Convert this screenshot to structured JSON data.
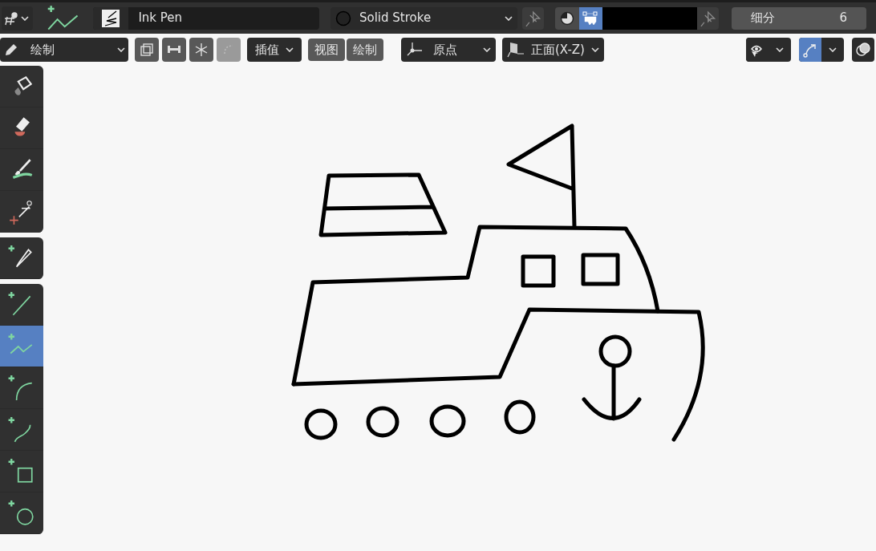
{
  "header": {
    "brush": "Ink Pen",
    "material": "Solid Stroke",
    "color_modes": [
      {
        "kind": "material",
        "selected": false
      },
      {
        "kind": "vertex",
        "selected": true
      }
    ],
    "subdivision": {
      "label": "细分",
      "value": "6"
    }
  },
  "toolbar": {
    "mode": "绘制",
    "toggles": [
      {
        "kind": "layers",
        "disabled": false
      },
      {
        "kind": "lock",
        "disabled": false
      },
      {
        "kind": "freeze",
        "disabled": false
      },
      {
        "kind": "chain",
        "disabled": true
      }
    ],
    "interpolate": "插值",
    "buttons": [
      "视图",
      "绘制"
    ],
    "pivot": "原点",
    "plane": "正面(X-Z)",
    "overlays": [
      {
        "kind": "visibility",
        "selected": false
      },
      {
        "kind": "gizmo",
        "selected": true
      },
      {
        "kind": "overlay",
        "selected": false
      }
    ]
  },
  "tools": [
    [
      {
        "kind": "fill",
        "selected": false
      },
      {
        "kind": "erase",
        "selected": false
      },
      {
        "kind": "tint",
        "selected": false
      },
      {
        "kind": "cutter",
        "selected": false
      }
    ],
    [
      {
        "kind": "eyedropper",
        "selected": false
      }
    ],
    [
      {
        "kind": "line",
        "selected": false
      },
      {
        "kind": "polyline",
        "selected": true
      },
      {
        "kind": "arc",
        "selected": false
      },
      {
        "kind": "curve",
        "selected": false
      },
      {
        "kind": "box",
        "selected": false
      },
      {
        "kind": "circle",
        "selected": false
      }
    ]
  ]
}
